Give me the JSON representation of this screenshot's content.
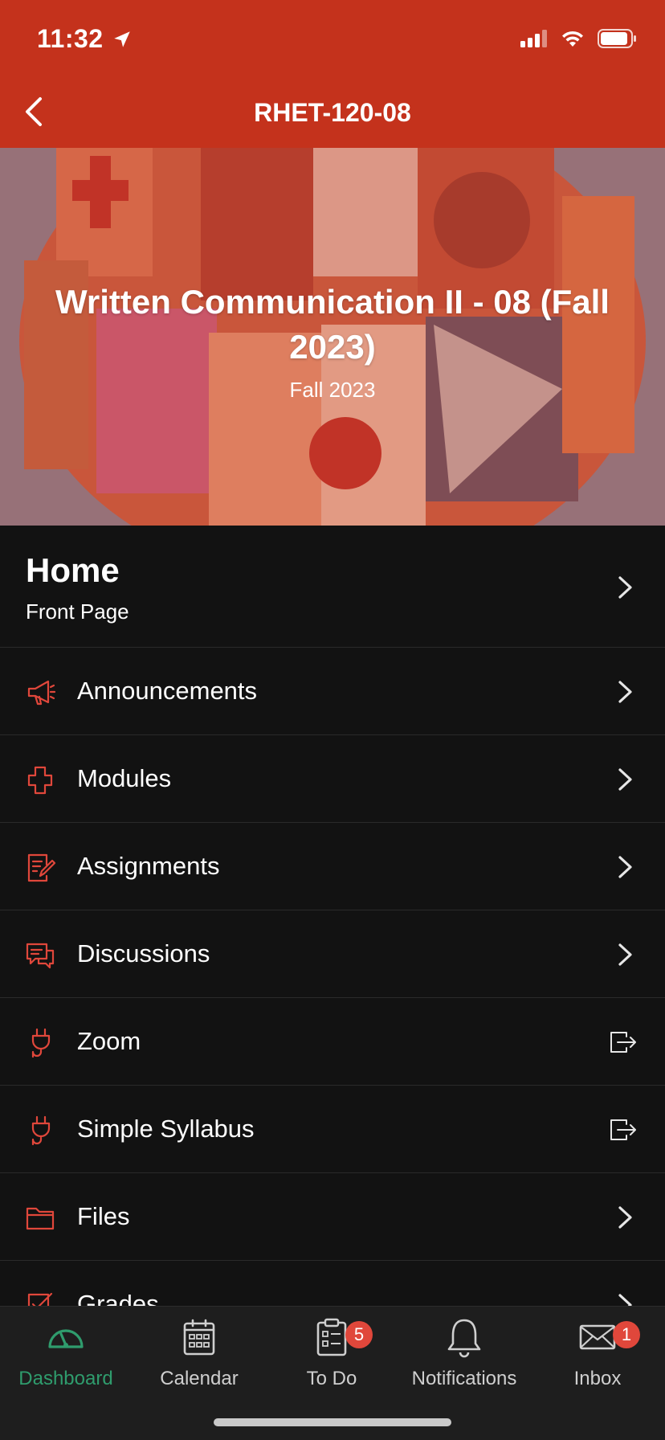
{
  "status_bar": {
    "time": "11:32"
  },
  "nav": {
    "title": "RHET-120-08"
  },
  "banner": {
    "course_title": "Written Communication II - 08 (Fall 2023)",
    "term": "Fall 2023"
  },
  "home": {
    "title": "Home",
    "subtitle": "Front Page"
  },
  "menu": [
    {
      "label": "Announcements",
      "icon": "megaphone-icon",
      "trailing": "chevron"
    },
    {
      "label": "Modules",
      "icon": "modules-icon",
      "trailing": "chevron"
    },
    {
      "label": "Assignments",
      "icon": "assignment-icon",
      "trailing": "chevron"
    },
    {
      "label": "Discussions",
      "icon": "discussion-icon",
      "trailing": "chevron"
    },
    {
      "label": "Zoom",
      "icon": "plug-icon",
      "trailing": "external"
    },
    {
      "label": "Simple Syllabus",
      "icon": "plug-icon",
      "trailing": "external"
    },
    {
      "label": "Files",
      "icon": "folder-icon",
      "trailing": "chevron"
    },
    {
      "label": "Grades",
      "icon": "grades-icon",
      "trailing": "chevron"
    }
  ],
  "tabs": [
    {
      "label": "Dashboard",
      "icon": "dashboard-icon",
      "active": true
    },
    {
      "label": "Calendar",
      "icon": "calendar-icon"
    },
    {
      "label": "To Do",
      "icon": "todo-icon",
      "badge": "5"
    },
    {
      "label": "Notifications",
      "icon": "bell-icon"
    },
    {
      "label": "Inbox",
      "icon": "inbox-icon",
      "badge": "1"
    }
  ],
  "colors": {
    "brand": "#c4321c",
    "accent_icon": "#e0473b",
    "active_tab": "#2f9c6d",
    "background": "#121212"
  }
}
